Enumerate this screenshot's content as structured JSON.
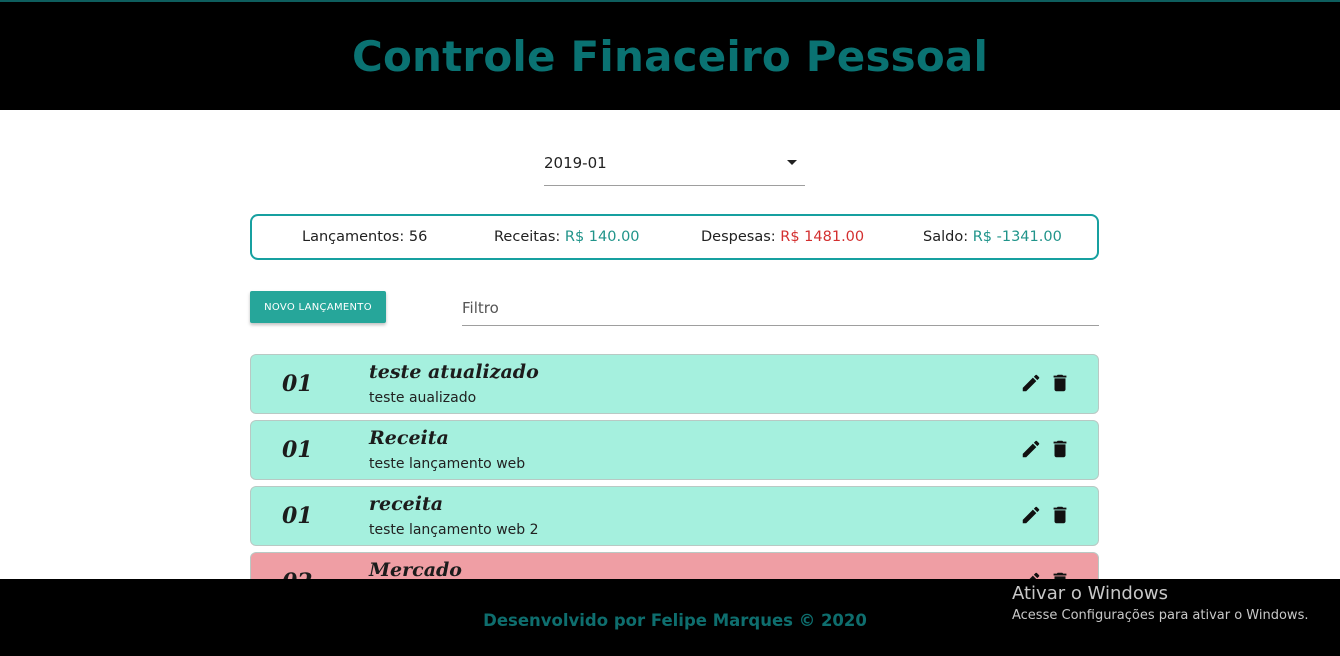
{
  "header": {
    "title": "Controle Finaceiro Pessoal"
  },
  "period": {
    "selected": "2019-01"
  },
  "summary": {
    "entries_label": "Lançamentos:",
    "entries_value": "56",
    "income_label": "Receitas:",
    "income_value": "R$ 140.00",
    "expenses_label": "Despesas:",
    "expenses_value": "R$ 1481.00",
    "balance_label": "Saldo:",
    "balance_value": "R$ -1341.00"
  },
  "toolbar": {
    "new_button_label": "Novo lançamento",
    "filter_placeholder": "Filtro"
  },
  "transactions": [
    {
      "day": "01",
      "category": "teste atualizado",
      "description": "teste aualizado",
      "type": "income"
    },
    {
      "day": "01",
      "category": "Receita",
      "description": "teste lançamento web",
      "type": "income"
    },
    {
      "day": "01",
      "category": "receita",
      "description": "teste lançamento web 2",
      "type": "income"
    },
    {
      "day": "02",
      "category": "Mercado",
      "description": "",
      "type": "expense"
    }
  ],
  "footer": {
    "credit": "Desenvolvido por Felipe Marques © 2020"
  },
  "os_watermark": {
    "title": "Ativar o Windows",
    "subtitle": "Acesse Configurações para ativar o Windows."
  },
  "colors": {
    "header_title": "#0a7272",
    "income_row": "#a5f0de",
    "expense_row": "#ef9ea4",
    "positive_value": "#20948a",
    "negative_value": "#d32f2f",
    "button": "#26a69a"
  },
  "icons": {
    "edit": "pencil-icon",
    "delete": "trash-icon"
  }
}
